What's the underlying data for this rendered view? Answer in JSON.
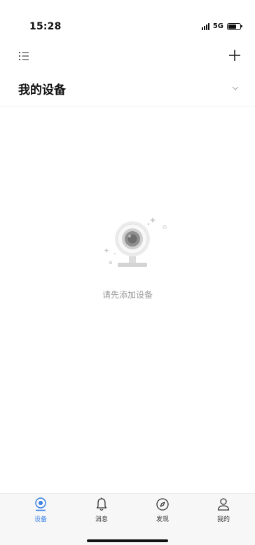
{
  "status_bar": {
    "time": "15:28",
    "network": "5G",
    "signal_icon": "signal-bars-icon",
    "battery_icon": "battery-icon",
    "battery_level": 0.7
  },
  "toolbar": {
    "menu_icon": "list-menu-icon",
    "add_icon": "plus-icon"
  },
  "header": {
    "title": "我的设备",
    "expand_icon": "chevron-down-icon"
  },
  "empty_state": {
    "illustration_icon": "camera-icon",
    "message": "请先添加设备"
  },
  "tab_bar": {
    "accent_color": "#3b82e6",
    "tabs": [
      {
        "label": "设备",
        "icon": "camera-icon",
        "active": true
      },
      {
        "label": "消息",
        "icon": "bell-icon",
        "active": false
      },
      {
        "label": "发现",
        "icon": "compass-icon",
        "active": false
      },
      {
        "label": "我的",
        "icon": "person-icon",
        "active": false
      }
    ]
  }
}
